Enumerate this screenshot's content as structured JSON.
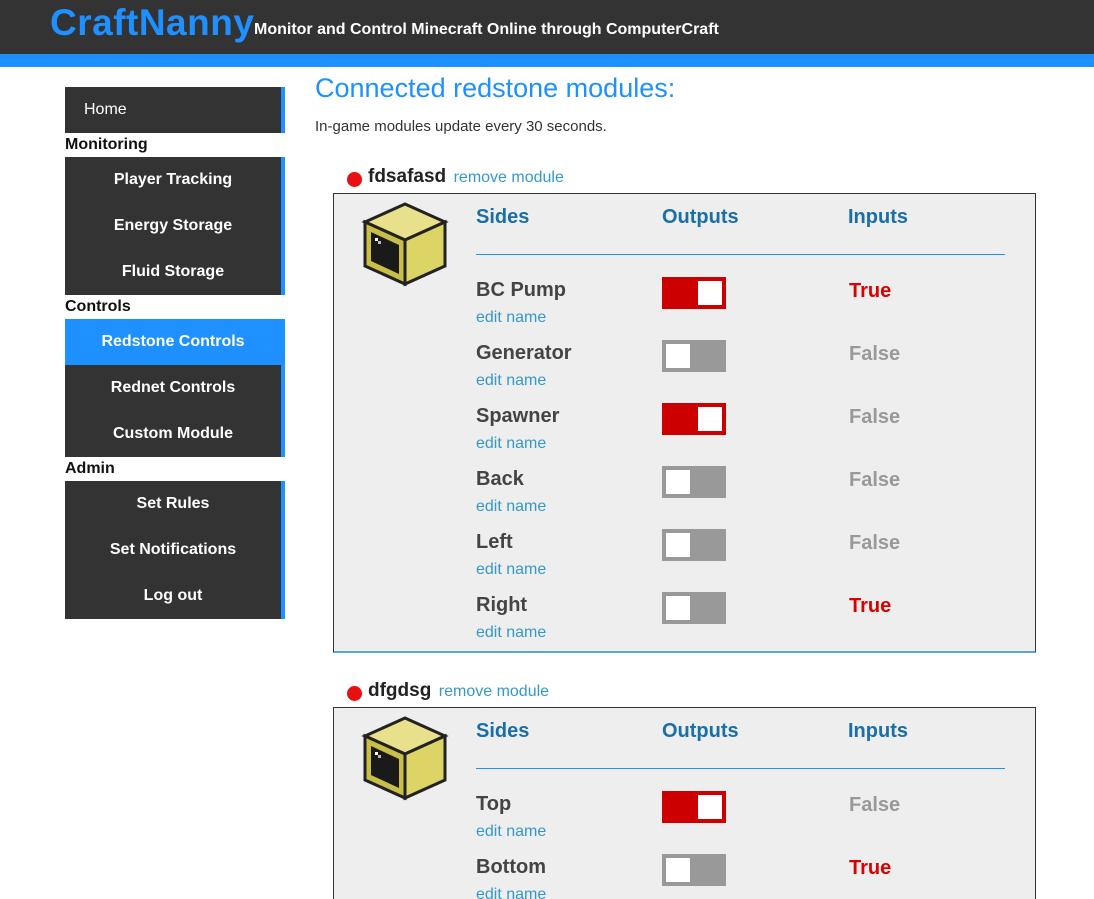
{
  "header": {
    "brand": "CraftNanny",
    "tagline": "Monitor and Control Minecraft Online through ComputerCraft",
    "brand_color": "#1e90ff",
    "bar_color": "#333333"
  },
  "sidebar": {
    "home": "Home",
    "sections": {
      "monitoring": "Monitoring",
      "controls": "Controls",
      "admin": "Admin"
    },
    "items": {
      "player_tracking": "Player Tracking",
      "energy_storage": "Energy Storage",
      "fluid_storage": "Fluid Storage",
      "redstone_controls": "Redstone Controls",
      "rednet_controls": "Rednet Controls",
      "custom_module": "Custom Module",
      "set_rules": "Set Rules",
      "set_notifications": "Set Notifications",
      "log_out": "Log out"
    },
    "active_item": "Redstone Controls"
  },
  "main": {
    "title": "Connected redstone modules:",
    "subtitle": "In-game modules update every 30 seconds.",
    "columns": {
      "sides": "Sides",
      "outputs": "Outputs",
      "inputs": "Inputs"
    },
    "remove_label": "remove module",
    "edit_label": "edit name",
    "modules": [
      {
        "name": "fdsafasd",
        "status_color": "#e81010",
        "sides": [
          {
            "name": "BC Pump",
            "output_on": true,
            "input": "True"
          },
          {
            "name": "Generator",
            "output_on": false,
            "input": "False"
          },
          {
            "name": "Spawner",
            "output_on": true,
            "input": "False"
          },
          {
            "name": "Back",
            "output_on": false,
            "input": "False"
          },
          {
            "name": "Left",
            "output_on": false,
            "input": "False"
          },
          {
            "name": "Right",
            "output_on": false,
            "input": "True"
          }
        ]
      },
      {
        "name": "dfgdsg",
        "status_color": "#e81010",
        "sides": [
          {
            "name": "Top",
            "output_on": true,
            "input": "False"
          },
          {
            "name": "Bottom",
            "output_on": false,
            "input": "True"
          }
        ]
      }
    ]
  }
}
